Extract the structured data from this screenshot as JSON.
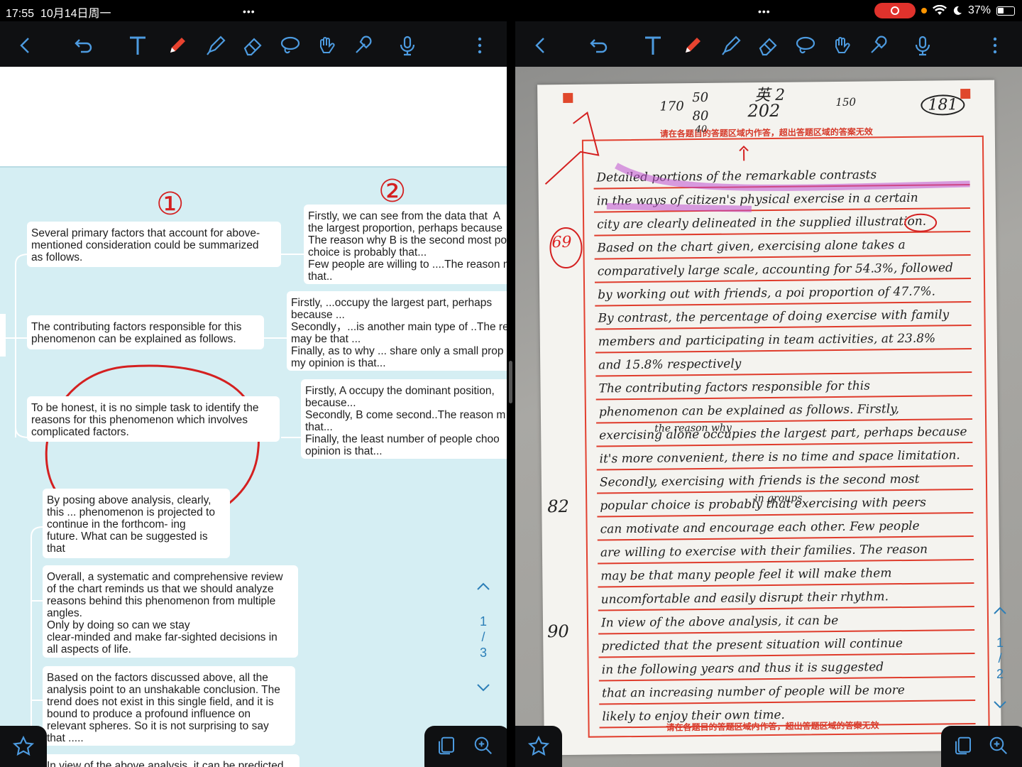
{
  "status": {
    "time": "17:55",
    "date": "10月14日周一",
    "battery": "37%",
    "dots": "•••"
  },
  "toolbar_icons": [
    "back-icon",
    "undo-icon",
    "text-icon",
    "pen-icon",
    "highlighter-icon",
    "eraser-icon",
    "lasso-icon",
    "hand-icon",
    "magic-pen-icon",
    "microphone-icon",
    "more-icon"
  ],
  "left": {
    "circle_numbers": [
      "①",
      "②"
    ],
    "cards": {
      "primary_factors": "Several primary factors that account for above-\nmentioned consideration could be summarized\nas follows.",
      "contributing": "The contributing factors responsible for this\nphenomenon can be explained as follows.",
      "honest": "To be honest, it is no simple task to identify the\nreasons for this phenomenon which involves\ncomplicated factors.",
      "firstly_data": "Firstly, we can see from the data that  A\nthe largest proportion, perhaps because\nThe reason why B is the second most po\nchoice is probably that...\nFew people are willing to ....The reason m\nthat..",
      "firstly_occupy": "Firstly, ...occupy the largest part, perhaps\nbecause ...\nSecondly，...is another main type of ..The re\nmay be that ...\nFinally, as to why ... share only a small prop\nmy opinion is that...",
      "firstly_dominant": "Firstly, A occupy the dominant position,\nbecause...\nSecondly, B come second..The reason m\nthat...\nFinally, the least number of people choo\nopinion is that...",
      "posing": "By posing above analysis, clearly,\nthis ... phenomenon is projected to\ncontinue in the forthcom- ing\nfuture. What can be suggested is\nthat",
      "overall": "Overall, a systematic and comprehensive review\nof the chart reminds us that we should analyze\nreasons behind this phenomenon from multiple\nangles.\nOnly by doing so can we stay\nclear-minded and make far-sighted decisions in\nall aspects of life.",
      "based": "Based on the factors discussed above, all the\nanalysis point to an unshakable conclusion. The\ntrend does not exist in this single field, and it is\nbound to produce a profound influence on\nrelevant spheres. So it is not surprising to say\nthat .....",
      "in_view": "In view of the above analysis, it can be predicted"
    },
    "pager": {
      "current": "1",
      "sep": "/",
      "total": "3"
    }
  },
  "right": {
    "header_scores": [
      "170",
      "50",
      "80",
      "40",
      "英 2",
      "202",
      "150",
      "181"
    ],
    "margin_scores": [
      "69",
      "82",
      "90"
    ],
    "warning_top": "请在各题目的答题区域内作答，超出答题区域的答案无效",
    "warning_bottom": "请在各题目的答题区域内作答，超出答题区域的答案无效",
    "lines": [
      "Detailed   portions   of   the   remarkable   contrasts",
      "in  the  ways  of  citizen's  physical  exercise  in  a  certain",
      "city  are  clearly  delineated  in  the  supplied  illustration.",
      "Based   on  the  chart  given,  exercising  alone  takes  a",
      "comparatively  large  scale,  accounting  for  54.3%,  followed",
      "by  working  out  with  friends,  a  poi  proportion  of  47.7%.",
      "By  contrast,  the  percentage  of  doing  exercise  with  family",
      "members  and  participating  in  team  activities,  at  23.8%",
      "and  15.8%  respectively",
      "     The   contributing   factors   responsible   for   this",
      "phenomenon  can  be  explained  as  follows.  Firstly,",
      "exercising  alone  occupies  the  largest  part,  perhaps  because",
      "it's  more  convenient,  there  is  no  time  and  space  limitation.",
      "Secondly,  exercising  with  friends  is  the  second  most",
      "popular  choice  is  probably  that  exercising  with  peers",
      "can  motivate  and  encourage  each  other.  Few  people",
      "are  willing  to  exercise  with  their  families.  The  reason",
      "may  be  that  many  people  feel  it  will  make  them",
      "uncomfortable  and  easily  disrupt  their  rhythm.",
      "     In   view   of   the   above   analysis,   it   can   be",
      "predicted   that   the   present   situation   will   continue",
      "in  the  following  years  and  thus  it  is  suggested",
      "that  an  increasing  number  of  people  will  be  more",
      "likely  to  enjoy  their  own  time."
    ],
    "insert_note": "the reason why",
    "insert_note2": "in   groups",
    "pager": {
      "current": "1",
      "sep": "/",
      "total": "2"
    }
  }
}
